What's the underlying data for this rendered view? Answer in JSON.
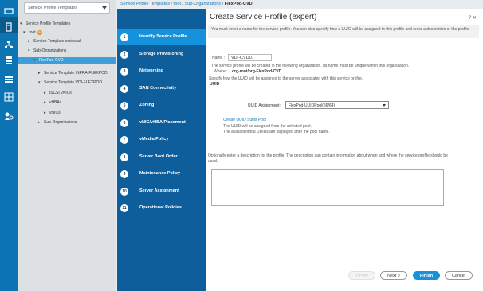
{
  "nav": {
    "filter_value": "Service Profile Templates",
    "tree": [
      {
        "label": "Service Profile Templates",
        "toggle": "▾"
      },
      {
        "label": "root",
        "toggle": "▾",
        "badge": "⊕"
      },
      {
        "label": "Service Template esxinstall",
        "toggle": "▸"
      },
      {
        "label": "Sub-Organizations",
        "toggle": "▾"
      },
      {
        "label": "FlexPod-CVD",
        "toggle": "▾",
        "selected": true
      },
      {
        "label": "Service Template INFRA-FLEXPOD",
        "toggle": "▸"
      },
      {
        "label": "Service Template VDI-FLEXPOD",
        "toggle": "▾"
      },
      {
        "label": "iSCSI vNICs",
        "toggle": "▸"
      },
      {
        "label": "vHBAs",
        "toggle": "▸"
      },
      {
        "label": "vNICs",
        "toggle": "▸"
      },
      {
        "label": "Sub-Organizations",
        "toggle": "▸"
      }
    ]
  },
  "breadcrumb": {
    "items": [
      "Service Profile Templates",
      "root",
      "Sub-Organizations"
    ],
    "current": "FlexPod-CVD",
    "sep": " / "
  },
  "wizard": {
    "title": "Create Service Profile (expert)",
    "header_icons": "? ✕",
    "intro": "You must enter a name for the service profile. You can also specify how a UUID will be assigned to this profile and enter a description of the profile.",
    "name_label": "Name :",
    "name_value": "VDI-CVD01",
    "org_note": "The service profile will be created in the following organization. Its name must be unique within this organization.",
    "where_label": "Where :",
    "where_value": "org-root/org-FlexPod-CVD",
    "uuid_note": "Specify how the UUID will be assigned to the server associated with this service profile.",
    "uuid_heading": "UUID",
    "uuid_label": "UUID Assignment:",
    "uuid_value": "FlexPod-UUIDPool(56/64)",
    "create_link": "Create UUID Suffix Pool",
    "pool_note1": "The UUID will be assigned from the selected pool.",
    "pool_note2": "The available/total UUIDs are displayed after the pool name.",
    "desc_note1": "Optionally enter a description for the profile. The description can contain information about when and where the service profile should be",
    "desc_note2": "used.",
    "steps": [
      {
        "num": "1",
        "label": "Identify Service Profile",
        "active": true
      },
      {
        "num": "2",
        "label": "Storage Provisioning"
      },
      {
        "num": "3",
        "label": "Networking"
      },
      {
        "num": "4",
        "label": "SAN Connectivity"
      },
      {
        "num": "5",
        "label": "Zoning"
      },
      {
        "num": "6",
        "label": "vNIC/vHBA Placement"
      },
      {
        "num": "7",
        "label": "vMedia Policy"
      },
      {
        "num": "8",
        "label": "Server Boot Order"
      },
      {
        "num": "9",
        "label": "Maintenance Policy"
      },
      {
        "num": "10",
        "label": "Server Assignment"
      },
      {
        "num": "11",
        "label": "Operational Policies"
      }
    ],
    "buttons": {
      "prev": "< Prev",
      "next": "Next >",
      "finish": "Finish",
      "cancel": "Cancel"
    }
  },
  "colors": {
    "rail": "#0c74b3",
    "steps_bg": "#0d5e9b",
    "accent": "#1592dc"
  }
}
